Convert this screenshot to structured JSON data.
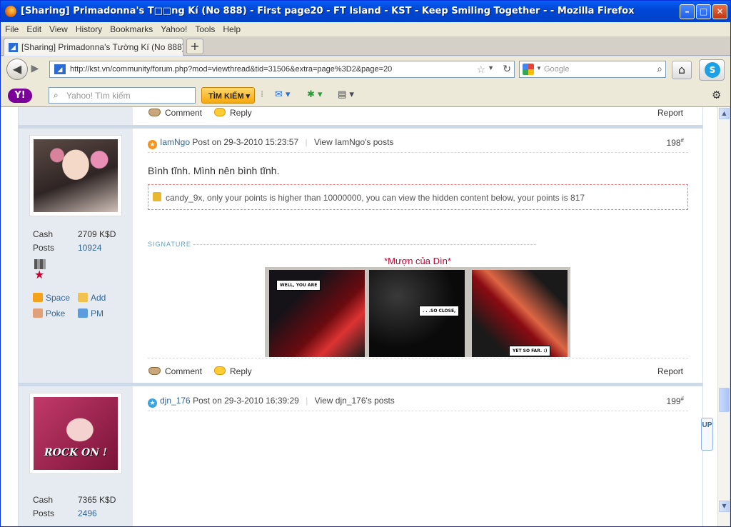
{
  "window": {
    "title": "[Sharing] Primadonna's T□□ng Kí (No 888) - First page20 - FT Island - KST - Keep Smiling Together - - Mozilla Firefox",
    "buttons": {
      "minimize": "–",
      "maximize": "□",
      "close": "✕"
    }
  },
  "menu": [
    "File",
    "Edit",
    "View",
    "History",
    "Bookmarks",
    "Yahoo!",
    "Tools",
    "Help"
  ],
  "tab": {
    "label": "[Sharing] Primadonna's Tường Kí (No 888) - ...",
    "new_tab": "+"
  },
  "nav": {
    "url": "http://kst.vn/community/forum.php?mod=viewthread&tid=31506&extra=page%3D2&page=20",
    "search_placeholder": "Google"
  },
  "yahoo_toolbar": {
    "logo": "Y!",
    "search_placeholder": "Yahoo! Tìm kiếm",
    "search_button": "TÌM KIẾM ▾"
  },
  "top_actions": {
    "comment": "Comment",
    "reply": "Reply",
    "report": "Report"
  },
  "posts": [
    {
      "author": "IamNgo",
      "post_on": "Post on 29-3-2010 15:23:57",
      "view_posts": "View IamNgo's posts",
      "floor": "198",
      "floor_mark": "#",
      "cash_label": "Cash",
      "cash_value": "2709 K$D",
      "posts_label": "Posts",
      "posts_value": "10924",
      "links": {
        "space": "Space",
        "add": "Add",
        "poke": "Poke",
        "pm": "PM"
      },
      "message": "Bình tĩnh. Mình nên bình tĩnh.",
      "locked_notice": "candy_9x, only your points is higher than 10000000, you can view the hidden content below, your points is 817",
      "signature_label": "SIGNATURE",
      "signature_caption": "*Mượn của Dìn*",
      "comic": {
        "panel1": "WELL, YOU ARE",
        "panel2": ". . .SO CLOSE,",
        "panel3": "YET SO FAR. :)"
      },
      "actions": {
        "comment": "Comment",
        "reply": "Reply",
        "report": "Report"
      }
    },
    {
      "author": "djn_176",
      "post_on": "Post on 29-3-2010 16:39:29",
      "view_posts": "View djn_176's posts",
      "floor": "199",
      "floor_mark": "#",
      "avatar_text": "ROCK ON !",
      "cash_label": "Cash",
      "cash_value": "7365 K$D",
      "posts_label": "Posts",
      "posts_value": "2496"
    }
  ],
  "up_button": "UP",
  "colors": {
    "titlebar": "#0054e3",
    "link": "#336699",
    "sidebar": "#e6ebf1",
    "accent_red": "#cc0033"
  }
}
